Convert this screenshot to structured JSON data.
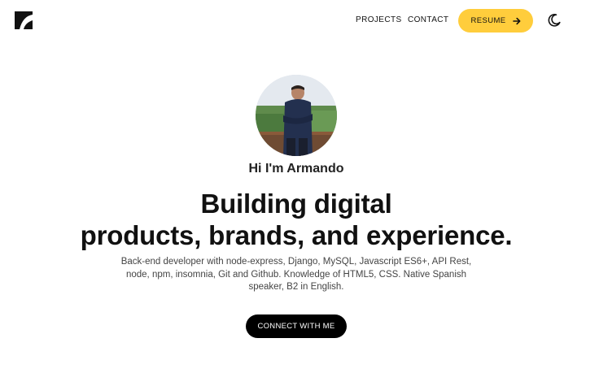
{
  "header": {
    "logo_icon": "brand-logo-icon",
    "nav": [
      {
        "label": "PROJECTS"
      },
      {
        "label": "CONTACT"
      }
    ],
    "resume_label": "RESUME",
    "resume_icon": "arrow-right-icon",
    "theme_icon": "moon-icon"
  },
  "hero": {
    "greeting": "Hi I'm Armando",
    "headline_line1": "Building digital",
    "headline_line2": "products, brands, and experience.",
    "bio": "Back-end developer with node-express, Django, MySQL, Javascript ES6+, API Rest, node, npm, insomnia, Git and Github. Knowledge of HTML5, CSS. Native Spanish speaker, B2 in English.",
    "cta_label": "CONNECT WITH ME"
  },
  "colors": {
    "accent": "#ffcd3c",
    "cta_bg": "#000000",
    "text": "#111111"
  }
}
